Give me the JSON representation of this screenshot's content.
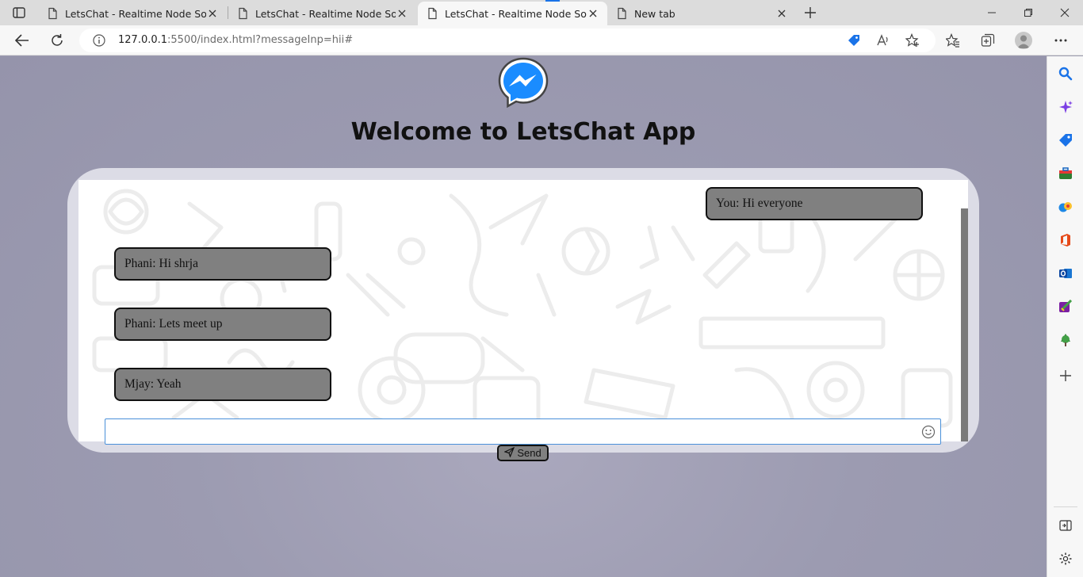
{
  "browser": {
    "tabs": [
      {
        "title": "LetsChat - Realtime Node Socket.io",
        "active": false
      },
      {
        "title": "LetsChat - Realtime Node Socket.io",
        "active": false
      },
      {
        "title": "LetsChat - Realtime Node Socket.io",
        "active": true
      },
      {
        "title": "New tab",
        "active": false
      }
    ],
    "address": {
      "host": "127.0.0.1",
      "rest": ":5500/index.html?messageInp=hii#"
    }
  },
  "page": {
    "heading": "Welcome to LetsChat App",
    "messages": [
      {
        "text": "You: Hi everyone",
        "side": "right"
      },
      {
        "text": "Phani: Hi shrja",
        "side": "left"
      },
      {
        "text": "Phani: Lets meet up",
        "side": "left"
      },
      {
        "text": "Mjay: Yeah",
        "side": "left"
      }
    ],
    "input": {
      "value": "",
      "placeholder": ""
    },
    "send_label": "Send"
  },
  "colors": {
    "background": "#9c9bb0",
    "bubble": "#808080",
    "container": "#dcdce6",
    "accent": "#1a73e8"
  }
}
